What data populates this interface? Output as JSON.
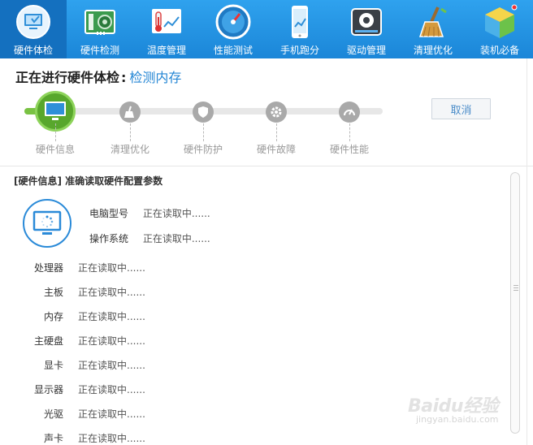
{
  "toolbar": {
    "items": [
      {
        "label": "硬件体检",
        "icon": "monitor-check-icon",
        "active": true
      },
      {
        "label": "硬件检测",
        "icon": "circuit-board-icon",
        "active": false
      },
      {
        "label": "温度管理",
        "icon": "thermometer-icon",
        "active": false
      },
      {
        "label": "性能测试",
        "icon": "speedometer-icon",
        "active": false
      },
      {
        "label": "手机跑分",
        "icon": "phone-benchmark-icon",
        "active": false
      },
      {
        "label": "驱动管理",
        "icon": "driver-gear-icon",
        "active": false
      },
      {
        "label": "清理优化",
        "icon": "broom-icon",
        "active": false
      },
      {
        "label": "装机必备",
        "icon": "box-cube-icon",
        "active": false
      }
    ],
    "colors": {
      "bar": "#1b86d8",
      "active": "#1470bf"
    }
  },
  "header": {
    "title": "正在进行硬件体检",
    "separator": ":",
    "current_step": "检测内存",
    "cancel_label": "取消"
  },
  "progress": {
    "completed_fraction": 0.04,
    "steps": [
      {
        "label": "硬件信息",
        "icon": "monitor-icon",
        "state": "active"
      },
      {
        "label": "清理优化",
        "icon": "broom-icon",
        "state": "pending"
      },
      {
        "label": "硬件防护",
        "icon": "shield-icon",
        "state": "pending"
      },
      {
        "label": "硬件故障",
        "icon": "gear-icon",
        "state": "pending"
      },
      {
        "label": "硬件性能",
        "icon": "gauge-icon",
        "state": "pending"
      }
    ],
    "colors": {
      "active": "#58a72c",
      "pending": "#a9a9a9",
      "fill": "#79c243"
    }
  },
  "info": {
    "section_title": "[硬件信息] 准确读取硬件配置参数",
    "summary": [
      {
        "key": "电脑型号",
        "value": "正在读取中......"
      },
      {
        "key": "操作系统",
        "value": "正在读取中......"
      }
    ],
    "rows": [
      {
        "key": "处理器",
        "value": "正在读取中......"
      },
      {
        "key": "主板",
        "value": "正在读取中......"
      },
      {
        "key": "内存",
        "value": "正在读取中......"
      },
      {
        "key": "主硬盘",
        "value": "正在读取中......"
      },
      {
        "key": "显卡",
        "value": "正在读取中......"
      },
      {
        "key": "显示器",
        "value": "正在读取中......"
      },
      {
        "key": "光驱",
        "value": "正在读取中......"
      },
      {
        "key": "声卡",
        "value": "正在读取中......"
      }
    ]
  },
  "watermark": {
    "logo": "Baidu经验",
    "url": "jingyan.baidu.com"
  }
}
